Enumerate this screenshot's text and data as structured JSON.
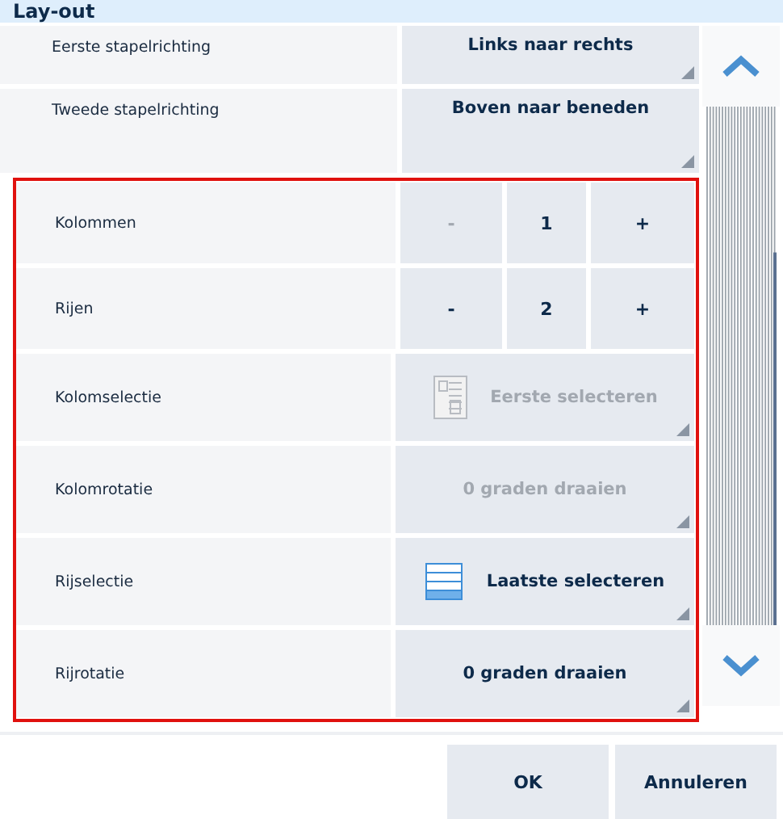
{
  "window": {
    "title": "Lay-out"
  },
  "settings": [
    {
      "kind": "choice",
      "label": "Eerste stapelrichting",
      "value": "Links naar rechts",
      "disabled": false
    },
    {
      "kind": "choice",
      "label": "Tweede stapelrichting",
      "value": "Boven naar beneden",
      "disabled": false
    }
  ],
  "highlighted_settings": [
    {
      "kind": "stepper",
      "label": "Kolommen",
      "minus": "-",
      "value": "1",
      "plus": "+",
      "minus_disabled": true
    },
    {
      "kind": "stepper",
      "label": "Rijen",
      "minus": "-",
      "value": "2",
      "plus": "+",
      "minus_disabled": false
    },
    {
      "kind": "choice",
      "label": "Kolomselectie",
      "value": "Eerste selecteren",
      "disabled": true
    },
    {
      "kind": "choice",
      "label": "Kolomrotatie",
      "value": "0 graden draaien",
      "disabled": true
    },
    {
      "kind": "choice",
      "label": "Rijselectie",
      "value": "Laatste selecteren",
      "disabled": false
    },
    {
      "kind": "choice",
      "label": "Rijrotatie",
      "value": "0 graden draaien",
      "disabled": false
    }
  ],
  "buttons": [
    "OK",
    "Annuleren"
  ]
}
